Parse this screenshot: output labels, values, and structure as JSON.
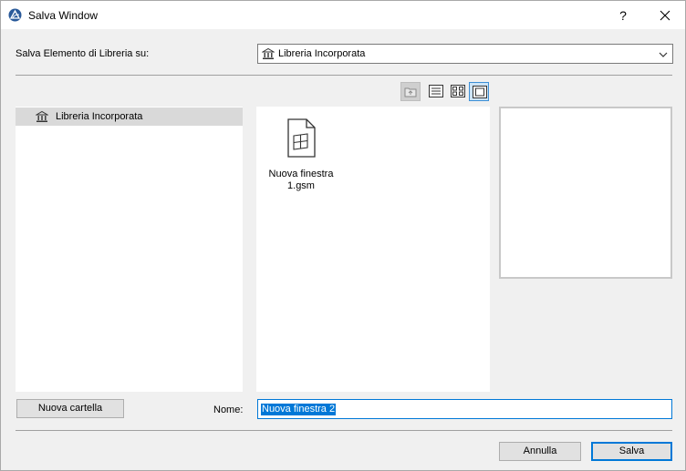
{
  "window": {
    "title": "Salva Window",
    "help_label": "?",
    "icons": {
      "app": "archicad-logo-icon",
      "close": "close-icon"
    }
  },
  "save_to": {
    "label": "Salva Elemento di Libreria su:",
    "selected": "Libreria Incorporata",
    "icon": "library-icon"
  },
  "view_modes": [
    {
      "name": "folder-up-icon",
      "state": "disabled"
    },
    {
      "name": "list-view-icon",
      "state": "normal"
    },
    {
      "name": "thumbnail-view-icon",
      "state": "normal"
    },
    {
      "name": "preview-view-icon",
      "state": "active"
    }
  ],
  "tree": {
    "items": [
      {
        "label": "Libreria Incorporata",
        "icon": "library-icon",
        "selected": true
      }
    ]
  },
  "files": {
    "items": [
      {
        "label": "Nuova finestra\n1.gsm",
        "icon": "window-object-file-icon"
      }
    ]
  },
  "footer": {
    "new_folder_label": "Nuova cartella",
    "name_label": "Nome:",
    "name_value": "Nuova finestra 2",
    "cancel_label": "Annulla",
    "save_label": "Salva"
  },
  "colors": {
    "accent": "#0078d7",
    "selection_bg": "#d9d9d9",
    "active_view_bg": "#cce4f7"
  }
}
